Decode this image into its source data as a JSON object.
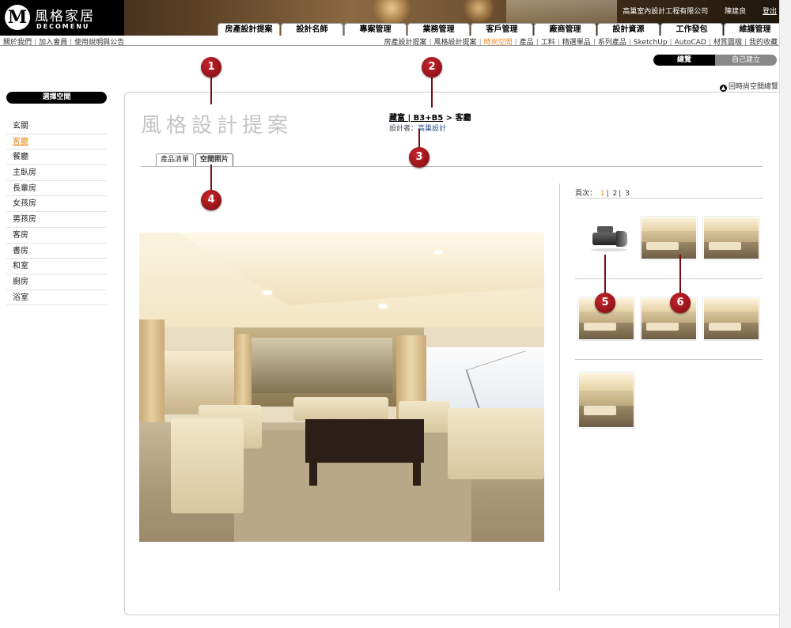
{
  "brand": {
    "logo_mark": "M",
    "name": "風格家居",
    "sub": "DECOMENU"
  },
  "top_links": {
    "company": "高巢室內設計工程有限公司",
    "user": "陳建良",
    "logout": "登出"
  },
  "main_nav": [
    "房產設計提案",
    "設計名師",
    "專案管理",
    "業務管理",
    "客戶管理",
    "廠商管理",
    "設計資源",
    "工作發包",
    "維護管理"
  ],
  "subnav_left": [
    "關於我們",
    "加入會員",
    "使用說明與公告"
  ],
  "subnav_right": [
    "房產設計提案",
    "風格設計提案",
    "時尚空間",
    "產品",
    "工料",
    "精選單品",
    "系列產品",
    "SketchUp",
    "AutoCAD",
    "材質圖檔",
    "我的收藏"
  ],
  "subnav_active_index": 2,
  "toggle": {
    "on": "總覽",
    "off": "自己建立"
  },
  "back_link": "回時尚空間總覽",
  "sidebar": {
    "title": "選擇空間",
    "items": [
      "玄關",
      "客廳",
      "餐廳",
      "主臥房",
      "長輩房",
      "女孩房",
      "男孩房",
      "客房",
      "書房",
      "和室",
      "廚房",
      "浴室"
    ],
    "selected_index": 1
  },
  "page_heading": "風格設計提案",
  "breadcrumb": {
    "project": "藏富 | B3+B5",
    "arrow": ">",
    "room": "客廳"
  },
  "designer": {
    "label": "設計者：",
    "name": "高巢設計"
  },
  "subtabs": [
    "產品清單",
    "空間照片"
  ],
  "subtabs_current": 1,
  "pager": {
    "label": "頁次：",
    "pages": [
      "1",
      "2",
      "3"
    ],
    "current": "1",
    "sep": "|"
  },
  "markers": [
    "1",
    "2",
    "3",
    "4",
    "5",
    "6"
  ],
  "icons": {
    "camera": "video-camera-icon",
    "back": "arrow-up-circle-icon"
  },
  "colors": {
    "accent": "#e58c1b",
    "marker": "#9b1218",
    "link": "#2a4f8a"
  }
}
